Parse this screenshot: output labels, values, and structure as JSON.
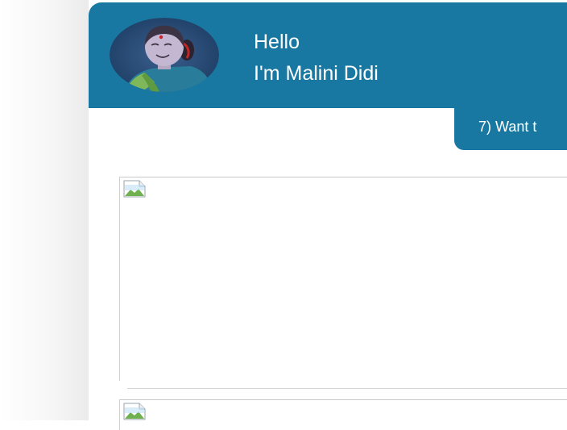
{
  "header": {
    "avatar_icon": "grandmother-avatar-icon",
    "greeting_line1": "Hello",
    "greeting_line2": "I'm Malini Didi",
    "background_color": "#1878a2"
  },
  "tab": {
    "label": "7) Want t"
  },
  "content": {
    "images": [
      {
        "icon": "broken-image-icon"
      },
      {
        "icon": "broken-image-icon"
      }
    ]
  }
}
